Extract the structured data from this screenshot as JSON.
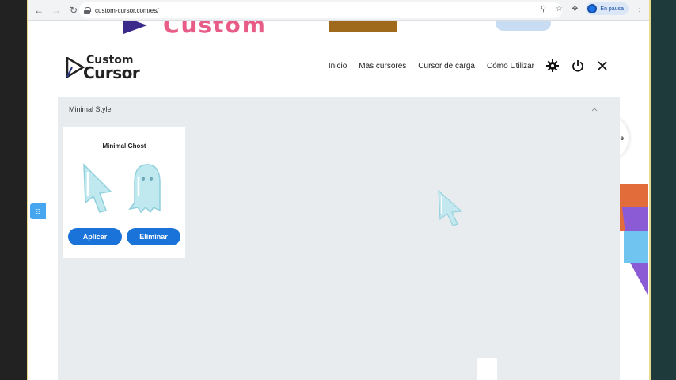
{
  "browser": {
    "url": "custom-cursor.com/es/",
    "profile_status": "En pausa"
  },
  "background_page": {
    "bubble_text": "ne"
  },
  "header": {
    "logo_small": "Custom",
    "logo_big": "Cursor",
    "nav": [
      "Inicio",
      "Mas cursores",
      "Cursor de carga",
      "Cómo Utilizar"
    ]
  },
  "section": {
    "title": "Minimal Style"
  },
  "card": {
    "title": "Minimal Ghost",
    "apply_label": "Aplicar",
    "remove_label": "Eliminar"
  },
  "colors": {
    "accent": "#1a73d8",
    "cursor_fill": "#bfe8ef",
    "overlay_bg": "#e8ecef"
  }
}
